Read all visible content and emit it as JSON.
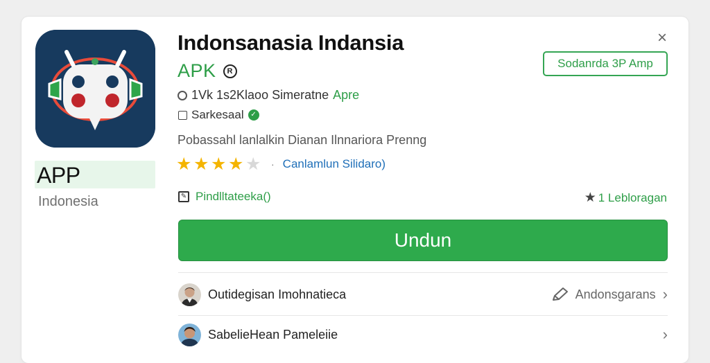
{
  "app": {
    "title": "Indonsanasia Indansia",
    "apk_label": "APK",
    "apk_badge": "R",
    "badge_text": "APP",
    "country": "Indonesia"
  },
  "header": {
    "close_symbol": "×",
    "secondary_button": "Sodanrda 3P Amp"
  },
  "meta": {
    "size_text": "1Vk 1s2Klaoo Simeratne",
    "accent_text": "Apre",
    "check_label": "Sarkesaal",
    "verified_symbol": "✓"
  },
  "description": "Pobassahl lanlalkin Dianan Ilnnariora Prenng",
  "rating": {
    "value": 4,
    "max": 5,
    "separator": "·",
    "link_text": "Canlamlun Silidaro)"
  },
  "permissions": {
    "icon_symbol": "✎",
    "label": "Pindlltateeka()"
  },
  "rank": {
    "star_symbol": "★",
    "label": "1 Lebloragan"
  },
  "download_button": "Undun",
  "list": [
    {
      "name": "Outidegisan Imohnatieca",
      "action_label": "Andonsgarans",
      "action_icon": "pencil-icon",
      "chevron": "›"
    },
    {
      "name": "SabelieHean Pameleiie",
      "action_label": "",
      "chevron": "›"
    }
  ],
  "colors": {
    "accent_green": "#2eaa4c",
    "link_blue": "#1f6fb8",
    "star_gold": "#f4b400",
    "icon_bg": "#173a5e"
  },
  "icons": {
    "app_icon": "android-robot-icon",
    "close": "close-icon",
    "verified": "check-circle-icon",
    "rank": "star-icon"
  }
}
